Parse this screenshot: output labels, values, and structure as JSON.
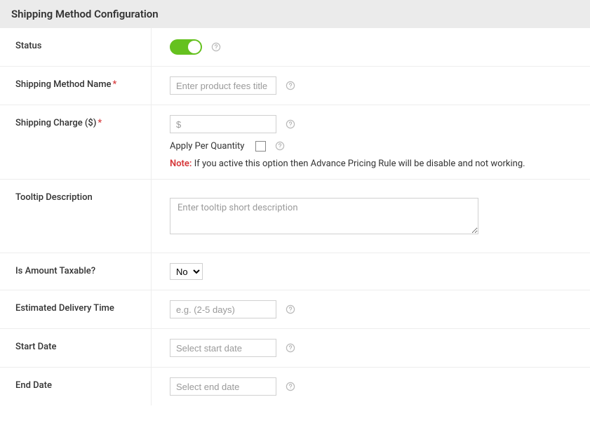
{
  "header": {
    "title": "Shipping Method Configuration"
  },
  "status": {
    "label": "Status"
  },
  "name": {
    "label": "Shipping Method Name",
    "required_mark": "*",
    "placeholder": "Enter product fees title"
  },
  "charge": {
    "label": "Shipping Charge ($)",
    "required_mark": "*",
    "placeholder": "$",
    "apply_per_qty_label": "Apply Per Quantity",
    "note_label": "Note:",
    "note_text": " If you active this option then Advance Pricing Rule will be disable and not working."
  },
  "tooltip": {
    "label": "Tooltip Description",
    "placeholder": "Enter tooltip short description"
  },
  "taxable": {
    "label": "Is Amount Taxable?",
    "selected": "No"
  },
  "delivery": {
    "label": "Estimated Delivery Time",
    "placeholder": "e.g. (2-5 days)"
  },
  "start_date": {
    "label": "Start Date",
    "placeholder": "Select start date"
  },
  "end_date": {
    "label": "End Date",
    "placeholder": "Select end date"
  }
}
